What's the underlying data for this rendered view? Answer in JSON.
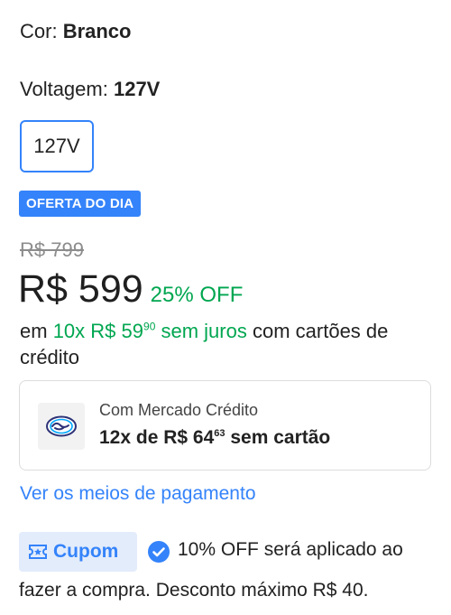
{
  "color": {
    "label": "Cor:",
    "value": "Branco"
  },
  "voltage": {
    "label": "Voltagem:",
    "value": "127V",
    "option": "127V"
  },
  "deal_badge": "OFERTA DO DIA",
  "pricing": {
    "old_price": "R$ 799",
    "price": "R$ 599",
    "discount": "25% OFF"
  },
  "installments": {
    "prefix": "em",
    "count": "10x",
    "amount": "R$ 59",
    "cents": "90",
    "interest": "sem juros",
    "suffix": "com cartões de crédito"
  },
  "credit": {
    "title": "Com Mercado Crédito",
    "main_prefix": "12x de R$ 64",
    "main_cents": "63",
    "main_suffix": "sem cartão"
  },
  "payment_link": "Ver os meios de pagamento",
  "coupon": {
    "badge": "Cupom",
    "line1": "10% OFF será aplicado ao",
    "line2": "fazer a compra. Desconto máximo R$ 40."
  },
  "colors": {
    "accent": "#3483fa",
    "green": "#00a650",
    "badge_bg": "#e3ecfb"
  }
}
